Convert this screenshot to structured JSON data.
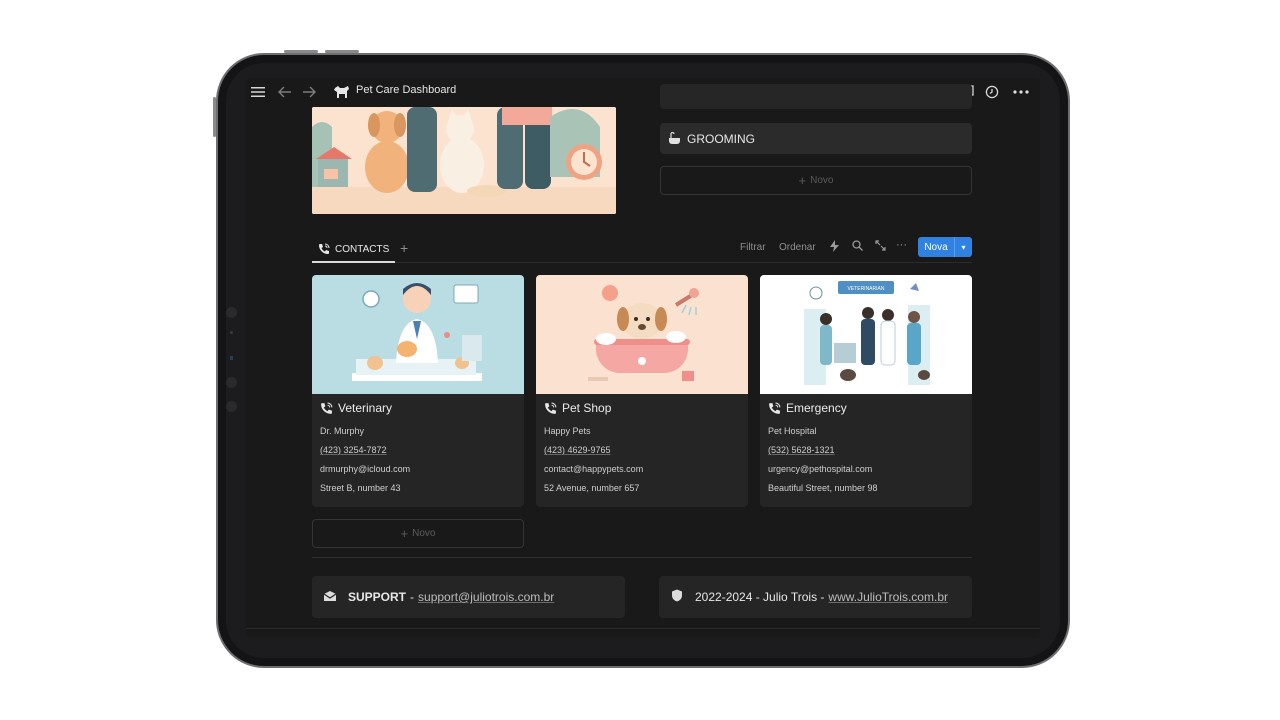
{
  "app": {
    "title": "Pet Care Dashboard"
  },
  "properties": {
    "grooming_label": "GROOMING",
    "novo_label": "Novo"
  },
  "contacts": {
    "tab_label": "CONTACTS",
    "toolbar": {
      "filter": "Filtrar",
      "sort": "Ordenar",
      "new_button": "Nova"
    },
    "cards": [
      {
        "title": "Veterinary",
        "name": "Dr. Murphy",
        "phone": "(423) 3254-7872",
        "email": "drmurphy@icloud.com",
        "address": "Street B, number 43"
      },
      {
        "title": "Pet Shop",
        "name": "Happy Pets",
        "phone": "(423) 4629-9765",
        "email": "contact@happypets.com",
        "address": "52 Avenue, number 657"
      },
      {
        "title": "Emergency",
        "name": "Pet Hospital",
        "phone": "(532) 5628-1321",
        "email": "urgency@pethospital.com",
        "address": "Beautiful Street, number 98"
      }
    ],
    "novo_label": "Novo",
    "vet_sign": "VETERINARIAN"
  },
  "footer": {
    "support_label": "SUPPORT",
    "support_dash": "-",
    "support_email": "support@juliotrois.com.br",
    "copyright": "2022-2024 - Julio Trois -",
    "website": "www.JulioTrois.com.br"
  },
  "colors": {
    "accent": "#2f81e2",
    "background": "#191919",
    "card": "#252525"
  }
}
